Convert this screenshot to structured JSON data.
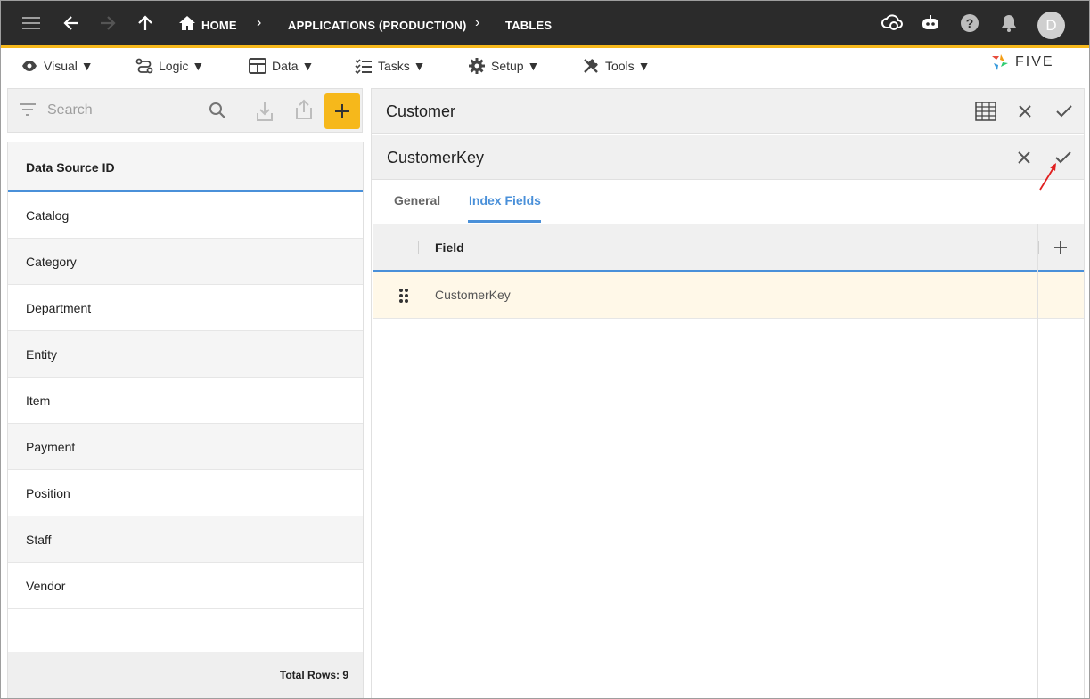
{
  "breadcrumb": {
    "home": "HOME",
    "app": "APPLICATIONS (PRODUCTION)",
    "current": "TABLES"
  },
  "user": {
    "initial": "D"
  },
  "menu": {
    "visual": "Visual ▼",
    "logic": "Logic ▼",
    "data": "Data ▼",
    "tasks": "Tasks ▼",
    "setup": "Setup ▼",
    "tools": "Tools ▼"
  },
  "logo": {
    "text": "FIVE"
  },
  "search": {
    "placeholder": "Search"
  },
  "list": {
    "header": "Data Source ID",
    "items": [
      "Catalog",
      "Category",
      "Department",
      "Entity",
      "Item",
      "Payment",
      "Position",
      "Staff",
      "Vendor"
    ],
    "footer": "Total Rows: 9"
  },
  "form": {
    "title": "Customer",
    "sub_title": "CustomerKey",
    "tabs": [
      "General",
      "Index Fields"
    ],
    "active_tab": "Index Fields",
    "grid": {
      "column": "Field",
      "rows": [
        "CustomerKey"
      ]
    }
  },
  "colors": {
    "accent": "#f6b81b",
    "topbar": "#2b2b2b",
    "tab_active": "#4a90d9",
    "row_highlight": "#fff8e8",
    "annotation_arrow": "#e02020"
  }
}
